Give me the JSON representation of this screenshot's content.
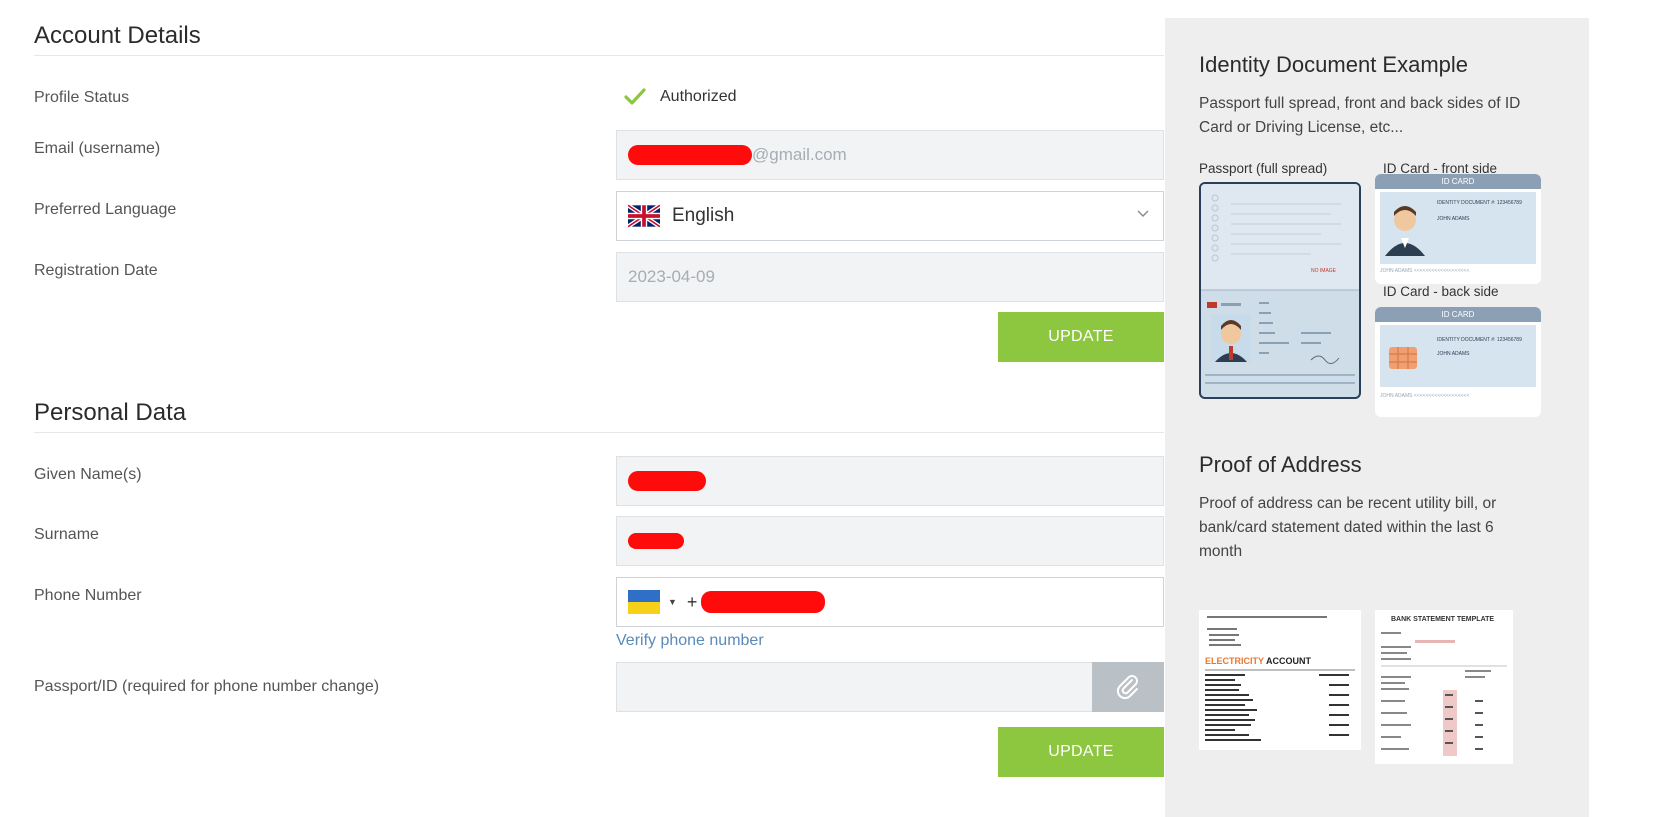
{
  "account": {
    "title": "Account Details",
    "profile_status_label": "Profile Status",
    "profile_status_value": "Authorized",
    "email_label": "Email (username)",
    "email_suffix": "@gmail.com",
    "language_label": "Preferred Language",
    "language_value": "English",
    "registration_label": "Registration Date",
    "registration_value": "2023-04-09",
    "update_label": "UPDATE"
  },
  "personal": {
    "title": "Personal Data",
    "given_name_label": "Given Name(s)",
    "surname_label": "Surname",
    "phone_label": "Phone Number",
    "phone_prefix": "+",
    "verify_label": "Verify phone number",
    "passport_label": "Passport/ID (required for phone number change)",
    "update_label": "UPDATE"
  },
  "sidebar": {
    "id_title": "Identity Document Example",
    "id_text": "Passport full spread, front and back sides of ID Card or Driving License, etc...",
    "passport_caption": "Passport (full spread)",
    "id_front_caption": "ID Card - front side",
    "id_back_caption": "ID Card - back side",
    "id_card_header": "ID CARD",
    "id_card_doc_line": "IDENTITY DOCUMENT #: 123456789",
    "id_card_name": "JOHN ADAMS",
    "id_card_mrz": "JOHN ADAMS <<<<<<<<<<<<<<<<<<<",
    "address_title": "Proof of Address",
    "address_text": "Proof of address can be recent utility bill, or bank/card statement dated within the last 6 month",
    "bill_heading_orange": "ELECTRICITY",
    "bill_heading_black": "ACCOUNT",
    "bank_heading": "BANK STATEMENT TEMPLATE"
  },
  "colors": {
    "accent": "#8dc63f",
    "link": "#5a8ab8",
    "redaction": "#ff0b0b"
  }
}
